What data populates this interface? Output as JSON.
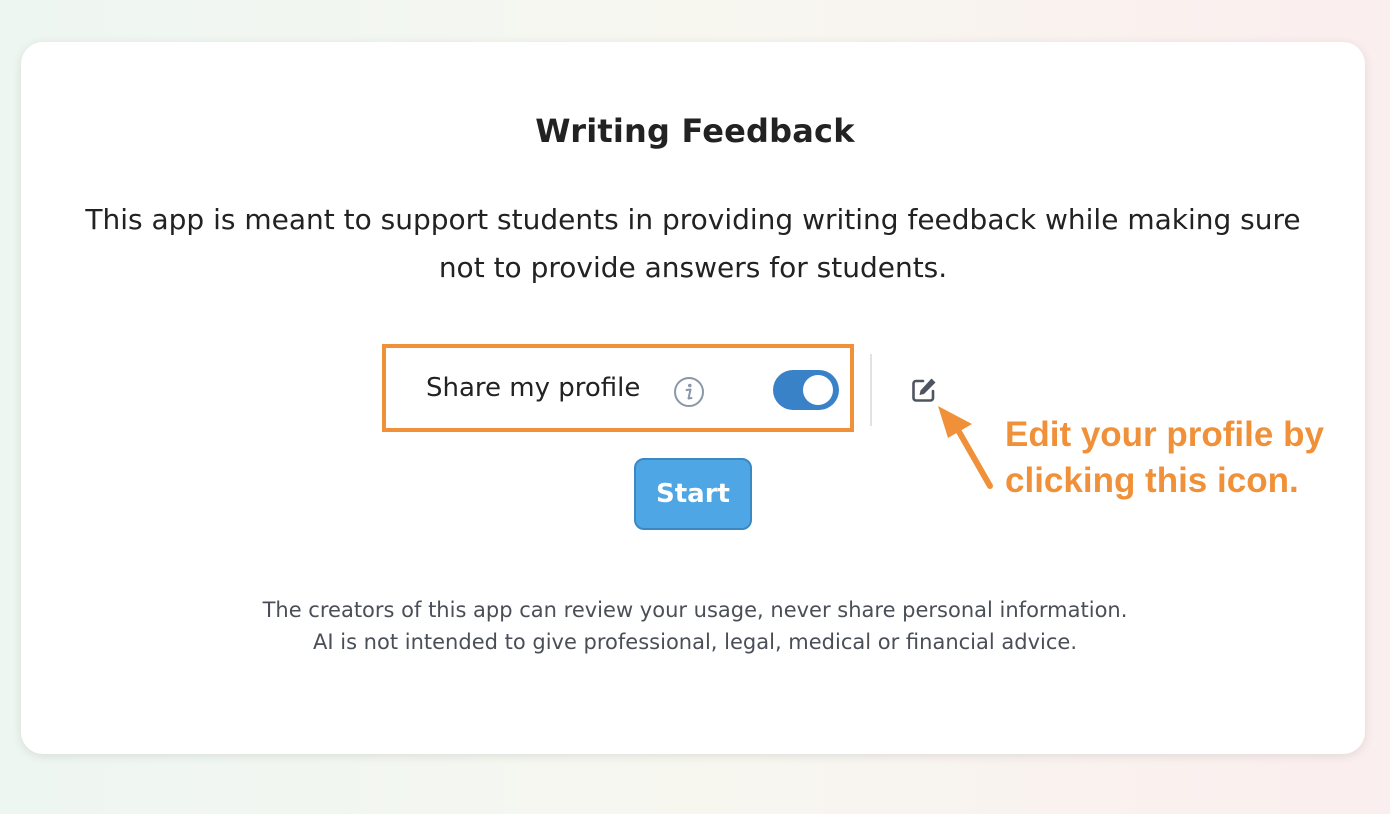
{
  "app": {
    "title": "Writing Feedback",
    "description": "This app is meant to support students in providing writing feedback while making sure not to provide answers for students."
  },
  "profile": {
    "share_label": "Share my profile",
    "share_enabled": true,
    "info_icon": "info-icon",
    "edit_icon": "edit-icon"
  },
  "actions": {
    "start_label": "Start"
  },
  "annotation": {
    "text": "Edit your profile by clicking this icon."
  },
  "footer": {
    "line1": "The creators of this app can review your usage, never share personal information.",
    "line2": "AI is not intended to give professional, legal, medical or financial advice."
  },
  "colors": {
    "accent_orange": "#f0913a",
    "toggle_blue": "#3a82c8",
    "button_blue": "#4ea7e4"
  }
}
